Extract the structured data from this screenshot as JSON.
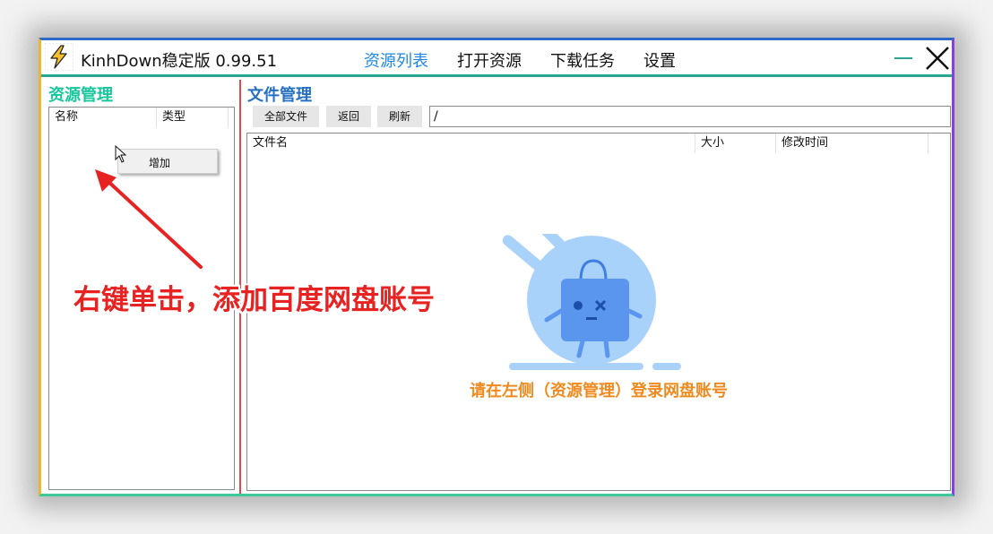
{
  "app": {
    "title": "KinhDown稳定版 0.99.51"
  },
  "menu": [
    "资源列表",
    "打开资源",
    "下载任务",
    "设置"
  ],
  "colors": {
    "accent_blue": "#1e88e5",
    "teal": "#2aa58e",
    "green_title": "#17c79c",
    "blue_title": "#2670c2",
    "annotation_red": "#e82121",
    "empty_orange": "#f08a1e"
  },
  "left_panel": {
    "title": "资源管理",
    "columns": [
      "名称",
      "类型"
    ],
    "context_menu": {
      "item": "增加"
    }
  },
  "right_panel": {
    "title": "文件管理",
    "toolbar": {
      "all_files": "全部文件",
      "back": "返回",
      "refresh": "刷新",
      "path": "/"
    },
    "columns": [
      "文件名",
      "大小",
      "修改时间"
    ],
    "empty_message": "请在左侧（资源管理）登录网盘账号"
  },
  "annotation": {
    "text": "右键单击，添加百度网盘账号"
  },
  "icons": {
    "logo": "lightning-icon",
    "cursor": "mouse-pointer-icon",
    "close": "close-icon",
    "minimize": "minimize-icon"
  }
}
